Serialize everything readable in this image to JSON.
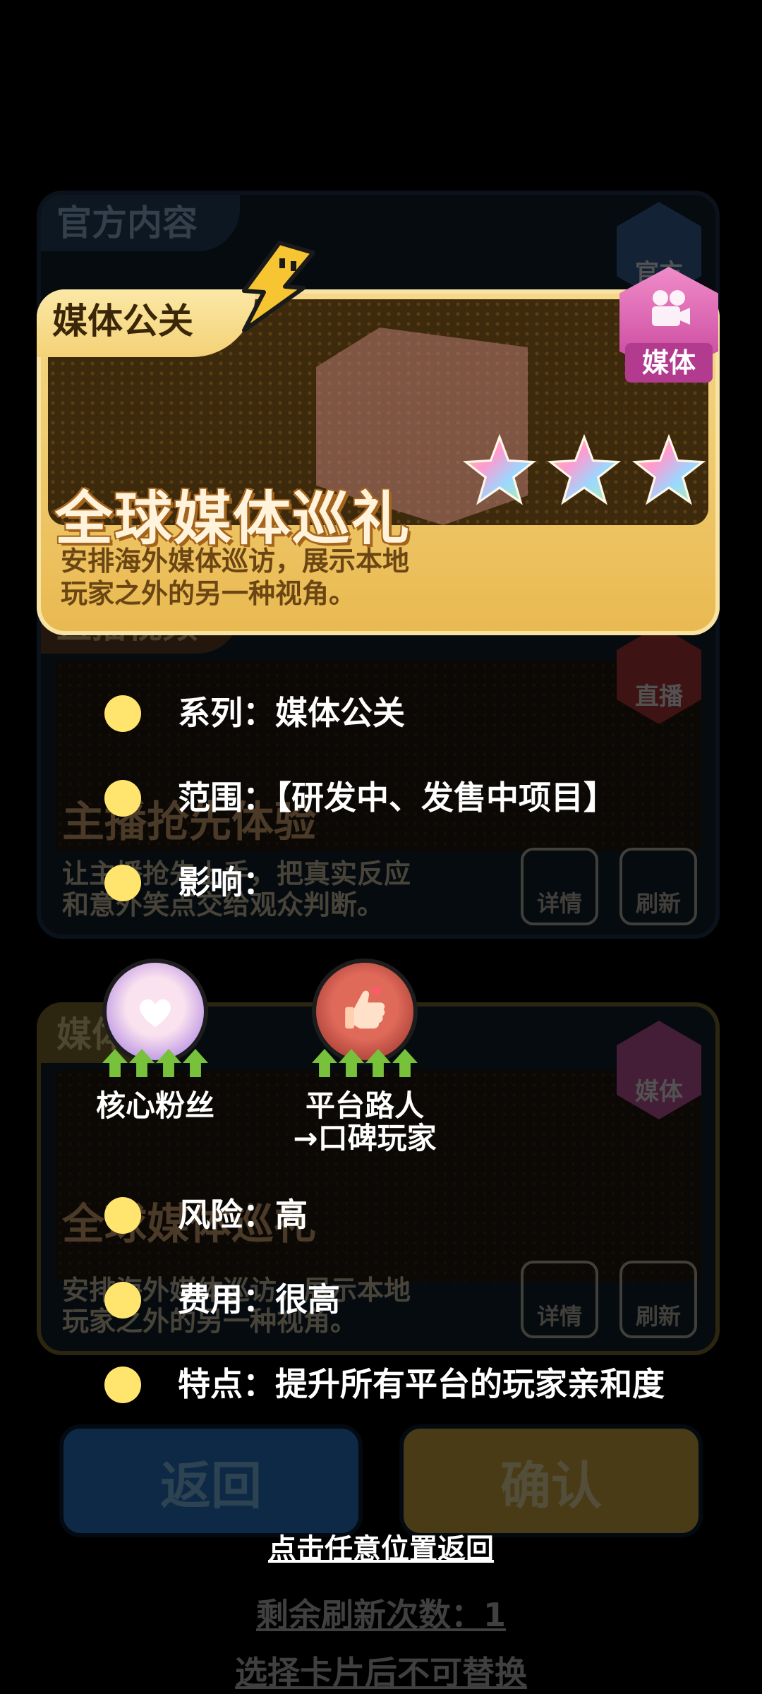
{
  "background": {
    "card_top": {
      "tab": "官方内容",
      "badge": "官方"
    },
    "card_mid": {
      "tab": "直播视频",
      "title": "主播抢先体验",
      "desc_line1": "让主播抢先上手，把真实反应",
      "desc_line2": "和意外笑点交给观众判断。",
      "badge": "直播",
      "details_label": "详情",
      "refresh_label": "刷新"
    },
    "card_bottom": {
      "tab": "媒体",
      "title": "全球媒体巡礼",
      "desc_line1": "安排海外媒体巡访，展示本地",
      "desc_line2": "玩家之外的另一种视角。",
      "badge": "媒体",
      "details_label": "详情",
      "refresh_label": "刷新"
    },
    "back_button": "返回",
    "confirm_button": "确认",
    "refresh_count": "剩余刷新次数：1",
    "warning": "选择卡片后不可替换"
  },
  "card": {
    "category": "媒体公关",
    "badge": "媒体",
    "title": "全球媒体巡礼",
    "desc_line1": "安排海外媒体巡访，展示本地",
    "desc_line2": "玩家之外的另一种视角。",
    "stars": 3
  },
  "details": [
    {
      "text": "系列：媒体公关"
    },
    {
      "text": "范围：【研发中、发售中项目】"
    },
    {
      "text": "影响："
    },
    {
      "text": "风险：高"
    },
    {
      "text": "费用：很高"
    },
    {
      "text": "特点：提升所有平台的玩家亲和度"
    }
  ],
  "audiences": [
    {
      "name": "核心粉丝",
      "icon": "heart-bubble-icon",
      "level": 4
    },
    {
      "name_line1": "平台路人",
      "name_line2": "→口碑玩家",
      "icon": "thumbs-up-icon",
      "level": 4
    }
  ],
  "dismiss_hint": "点击任意位置返回",
  "colors": {
    "accent_gold": "#f5d98a",
    "bullet": "#ffe56d",
    "media_badge": "#d45aa9",
    "arrow_green": "#77c23a"
  }
}
